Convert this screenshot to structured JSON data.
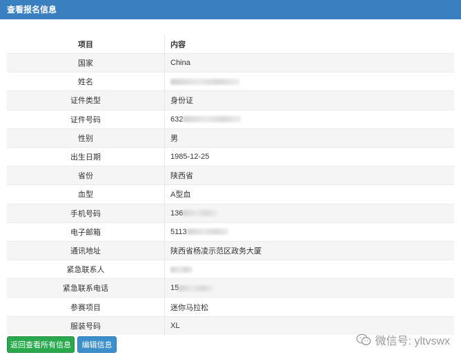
{
  "header": {
    "title": "查看报名信息"
  },
  "table": {
    "col_item": "项目",
    "col_content": "内容",
    "rows": [
      {
        "label": "国家",
        "value": "China"
      },
      {
        "label": "姓名",
        "value": ""
      },
      {
        "label": "证件类型",
        "value": "身份证"
      },
      {
        "label": "证件号码",
        "value": "632"
      },
      {
        "label": "性别",
        "value": "男"
      },
      {
        "label": "出生日期",
        "value": "1985-12-25"
      },
      {
        "label": "省份",
        "value": "陕西省"
      },
      {
        "label": "血型",
        "value": "A型血"
      },
      {
        "label": "手机号码",
        "value": "136"
      },
      {
        "label": "电子邮箱",
        "value": "5113"
      },
      {
        "label": "通讯地址",
        "value": "陕西省杨凌示范区政务大厦"
      },
      {
        "label": "紧急联系人",
        "value": ""
      },
      {
        "label": "紧急联系电话",
        "value": "15"
      },
      {
        "label": "参赛项目",
        "value": "迷你马拉松"
      },
      {
        "label": "服装号码",
        "value": "XL"
      }
    ]
  },
  "buttons": {
    "back_label": "返回查看所有信息",
    "edit_label": "编辑信息"
  },
  "watermark": {
    "text": "微信号: yltvswx",
    "icon": "wechat-icon"
  }
}
